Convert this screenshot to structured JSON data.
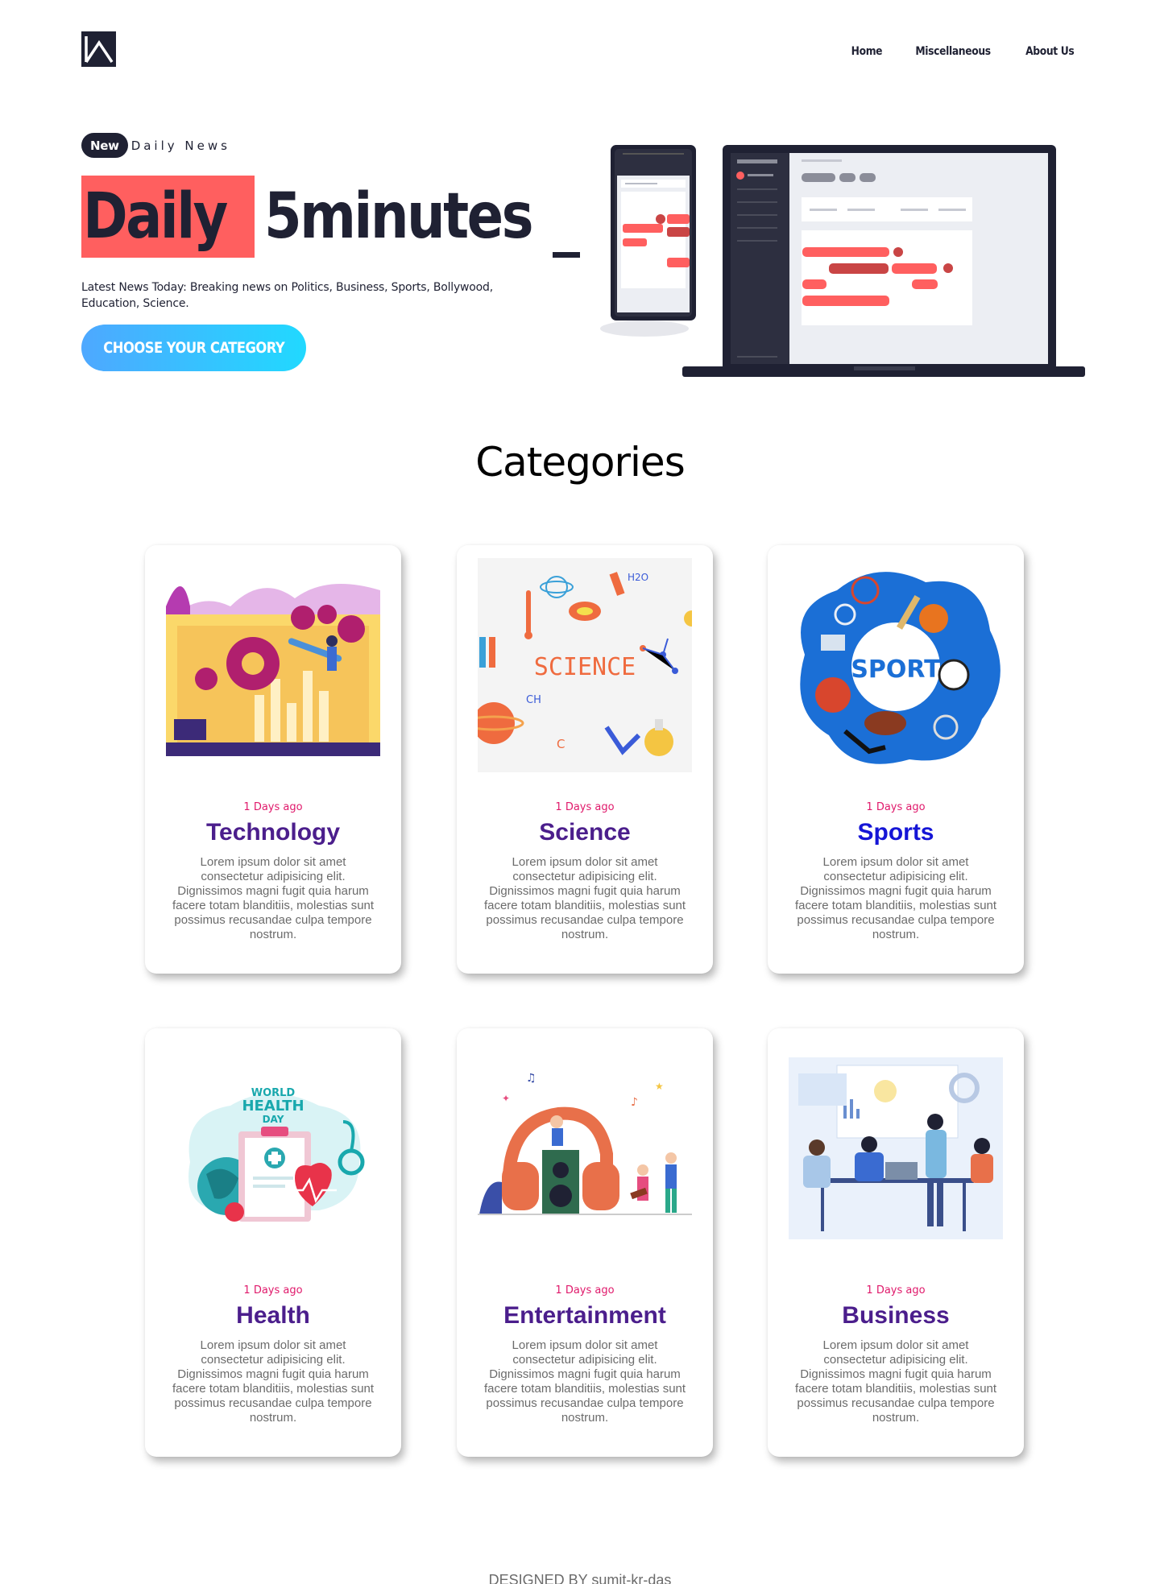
{
  "nav": {
    "items": [
      "Home",
      "Miscellaneous",
      "About Us"
    ]
  },
  "hero": {
    "badge": "New",
    "tagline": "Daily News",
    "title_highlight": "Daily",
    "title_rest": "5minutes",
    "description": "Latest News Today: Breaking news on Politics, Business, Sports, Bollywood, Education, Science.",
    "cta_label": "CHOOSE YOUR CATEGORY"
  },
  "categories": {
    "title": "Categories",
    "cards": [
      {
        "date": "1 Days ago",
        "title": "Technology",
        "description": "Lorem ipsum dolor sit amet consectetur adipisicing elit. Dignissimos magni fugit quia harum facere totam blanditiis, molestias sunt possimus recusandae culpa tempore nostrum."
      },
      {
        "date": "1 Days ago",
        "title": "Science",
        "description": "Lorem ipsum dolor sit amet consectetur adipisicing elit. Dignissimos magni fugit quia harum facere totam blanditiis, molestias sunt possimus recusandae culpa tempore nostrum."
      },
      {
        "date": "1 Days ago",
        "title": "Sports",
        "description": "Lorem ipsum dolor sit amet consectetur adipisicing elit. Dignissimos magni fugit quia harum facere totam blanditiis, molestias sunt possimus recusandae culpa tempore nostrum."
      },
      {
        "date": "1 Days ago",
        "title": "Health",
        "description": "Lorem ipsum dolor sit amet consectetur adipisicing elit. Dignissimos magni fugit quia harum facere totam blanditiis, molestias sunt possimus recusandae culpa tempore nostrum."
      },
      {
        "date": "1 Days ago",
        "title": "Entertainment",
        "description": "Lorem ipsum dolor sit amet consectetur adipisicing elit. Dignissimos magni fugit quia harum facere totam blanditiis, molestias sunt possimus recusandae culpa tempore nostrum."
      },
      {
        "date": "1 Days ago",
        "title": "Business",
        "description": "Lorem ipsum dolor sit amet consectetur adipisicing elit. Dignissimos magni fugit quia harum facere totam blanditiis, molestias sunt possimus recusandae culpa tempore nostrum."
      }
    ],
    "image_labels": {
      "science": "SCIENCE",
      "science_h2o": "H2O",
      "science_ch2": "CH",
      "science_c2h8": "C",
      "sport": "SPORT",
      "health_line1": "WORLD",
      "health_line2": "HEALTH",
      "health_line3": "DAY"
    }
  },
  "footer": {
    "text": "DESIGNED BY sumit-kr-das"
  },
  "colors": {
    "accent": "#ff5f5f",
    "dark": "#1f2133",
    "cta_start": "#4ea8ff",
    "cta_end": "#21d9ff",
    "card_title": "#4b1e8c",
    "sports_title": "#1515d6",
    "date": "#e0196b"
  }
}
